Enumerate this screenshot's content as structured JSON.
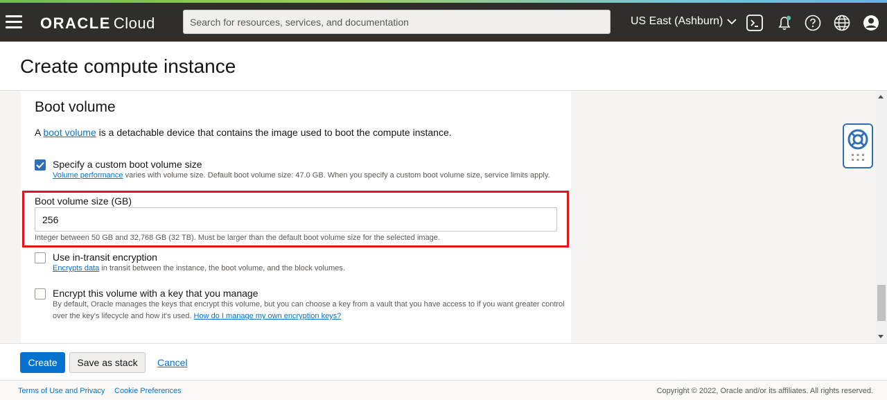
{
  "header": {
    "logo_brand": "ORACLE",
    "logo_product": "Cloud",
    "search_placeholder": "Search for resources, services, and documentation",
    "region": "US East (Ashburn)",
    "icons": [
      "menu-icon",
      "cloud-shell-icon",
      "bell-icon",
      "help-icon",
      "globe-icon",
      "user-icon"
    ]
  },
  "page": {
    "title": "Create compute instance"
  },
  "boot_volume": {
    "section_title": "Boot volume",
    "intro_prefix": "A",
    "intro_link": "boot volume",
    "intro_suffix": "is a detachable device that contains the image used to boot the compute instance.",
    "custom_size": {
      "label": "Specify a custom boot volume size",
      "checked": true,
      "help_link": "Volume performance",
      "help_text": "varies with volume size. Default boot volume size: 47.0 GB. When you specify a custom boot volume size, service limits apply."
    },
    "size_field": {
      "label": "Boot volume size (GB)",
      "value": "256",
      "help": "Integer between 50 GB and 32,768 GB (32 TB). Must be larger than the default boot volume size for the selected image."
    },
    "in_transit": {
      "label": "Use in-transit encryption",
      "checked": false,
      "help_link": "Encrypts data",
      "help_text": "in transit between the instance, the boot volume, and the block volumes."
    },
    "own_key": {
      "label": "Encrypt this volume with a key that you manage",
      "checked": false,
      "help_text": "By default, Oracle manages the keys that encrypt this volume, but you can choose a key from a vault that you have access to if you want greater control over the key's lifecycle and how it's used.",
      "help_link": "How do I manage my own encryption keys?"
    }
  },
  "actions": {
    "create": "Create",
    "save_stack": "Save as stack",
    "cancel": "Cancel"
  },
  "footer": {
    "terms": "Terms of Use and Privacy",
    "cookies": "Cookie Preferences",
    "copyright": "Copyright © 2022, Oracle and/or its affiliates. All rights reserved."
  },
  "colors": {
    "topbar": "#312d2a",
    "link": "#0572ce",
    "primary_button": "#0572ce",
    "highlight_border": "#e5121e",
    "checkbox_checked": "#2f6fb6"
  }
}
